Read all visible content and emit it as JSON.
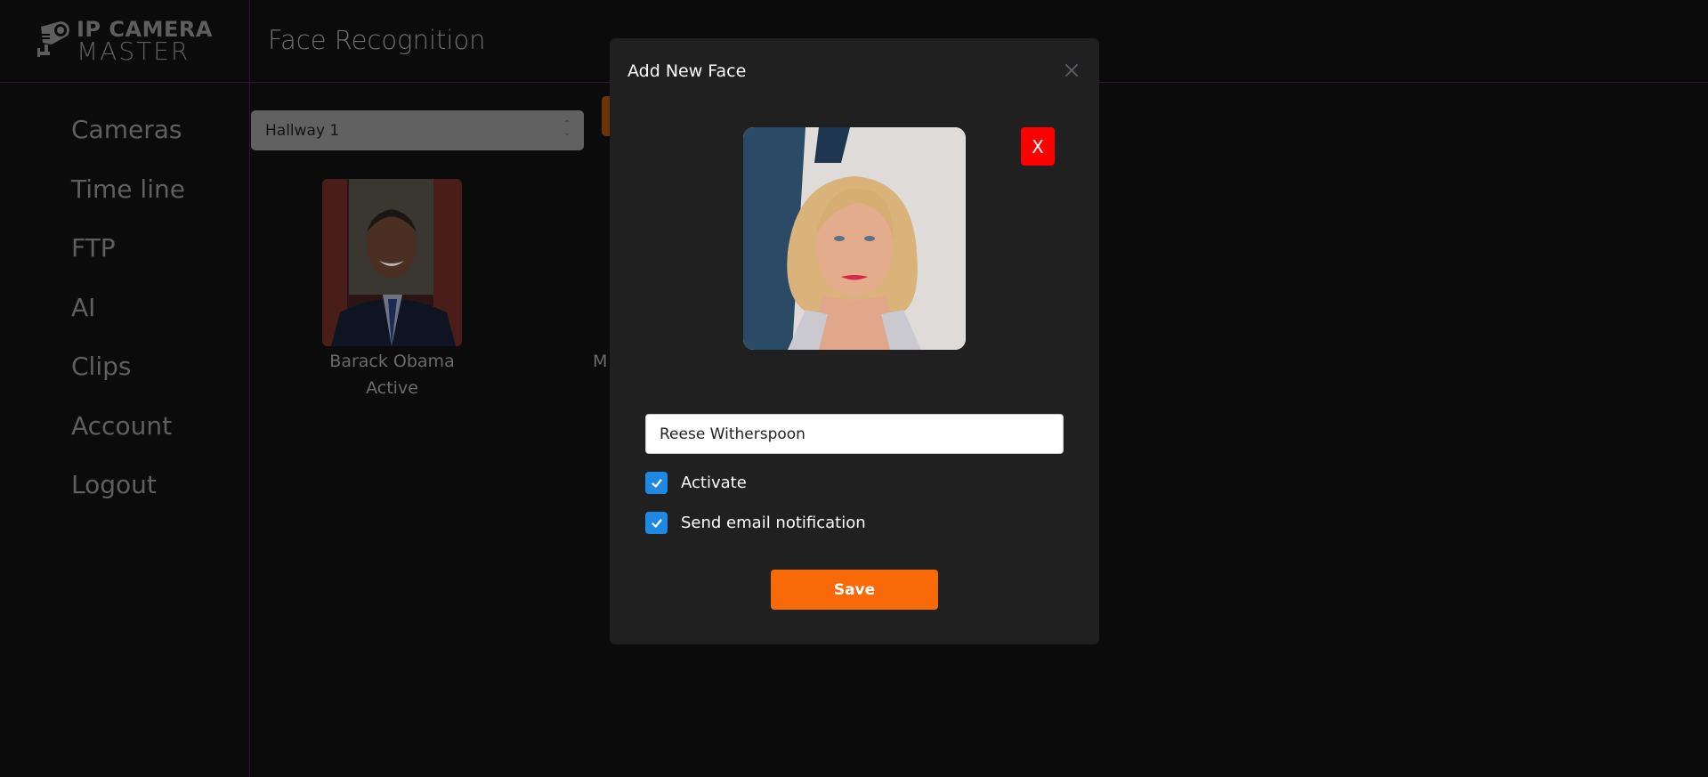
{
  "app": {
    "logo": {
      "line1": "IP CAMERA",
      "line2": "MASTER"
    },
    "page_title": "Face Recognition"
  },
  "sidebar": {
    "items": [
      {
        "label": "Cameras"
      },
      {
        "label": "Time line"
      },
      {
        "label": "FTP"
      },
      {
        "label": "AI"
      },
      {
        "label": "Clips"
      },
      {
        "label": "Account"
      },
      {
        "label": "Logout"
      }
    ]
  },
  "toolbar": {
    "camera_select": {
      "value": "Hallway 1"
    }
  },
  "faces": [
    {
      "name": "Barack Obama",
      "status": "Active"
    },
    {
      "name_partial": "M"
    }
  ],
  "modal": {
    "title": "Add New Face",
    "close_icon": "close-icon",
    "remove_photo_label": "X",
    "name_input": {
      "value": "Reese Witherspoon"
    },
    "checkboxes": [
      {
        "label": "Activate",
        "checked": true
      },
      {
        "label": "Send email notification",
        "checked": true
      }
    ],
    "save_label": "Save"
  },
  "colors": {
    "accent_orange": "#f86a08",
    "danger_red": "#ff0000",
    "checkbox_blue": "#1e88e5",
    "modal_bg": "#202020",
    "divider_purple": "#3a0f3a"
  }
}
